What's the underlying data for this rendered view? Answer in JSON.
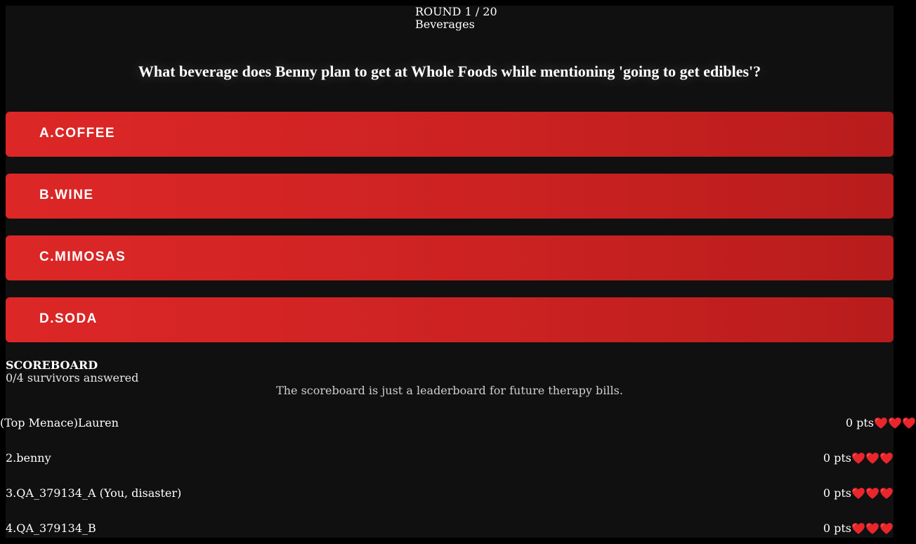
{
  "round": {
    "label": "ROUND 1 / 20",
    "category": "Beverages"
  },
  "question": "What beverage does Benny plan to get at Whole Foods while mentioning 'going to get edibles'?",
  "answers": [
    {
      "label": "A.COFFEE"
    },
    {
      "label": "B.WINE"
    },
    {
      "label": "C.MIMOSAS"
    },
    {
      "label": "D.SODA"
    }
  ],
  "scoreboard": {
    "title": "SCOREBOARD",
    "answered": "0/4 survivors answered",
    "note": "The scoreboard is just a leaderboard for future therapy bills.",
    "players": [
      {
        "name": "(Top Menace)Lauren",
        "points": "0 pts",
        "lives": 3
      },
      {
        "name": "2.benny",
        "points": "0 pts",
        "lives": 3
      },
      {
        "name": "3.QA_379134_A (You, disaster)",
        "points": "0 pts",
        "lives": 3
      },
      {
        "name": "4.QA_379134_B",
        "points": "0 pts",
        "lives": 3
      }
    ]
  },
  "icons": {
    "life": "heart-icon"
  },
  "colors": {
    "background": "#000000",
    "panel": "#101010",
    "answer_red": "#dd2727",
    "answer_red_dark": "#b81c1c",
    "heart": "#e8262b"
  }
}
